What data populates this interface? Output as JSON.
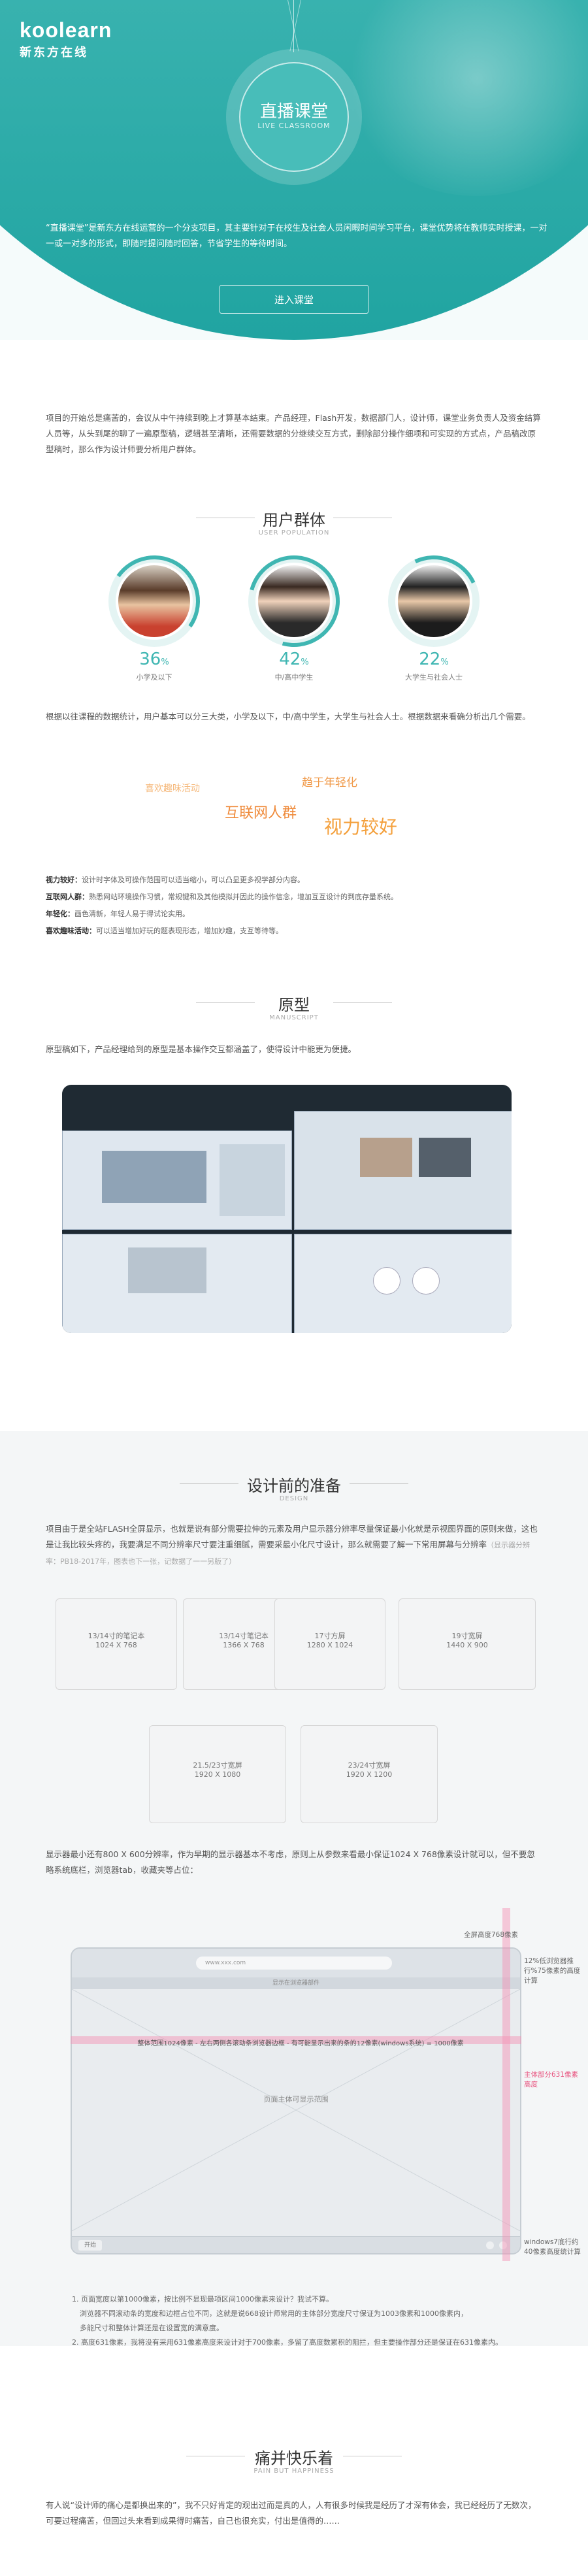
{
  "hero": {
    "logo_en": "koolearn",
    "logo_cn": "新东方在线",
    "badge_title": "直播课堂",
    "badge_sub": "LIVE CLASSROOM",
    "desc": "“直播课堂”是新东方在线运营的一个分支项目，其主要针对于在校生及社会人员闲暇时间学习平台，课堂优势将在教师实时授课，一对一或一对多的形式，即随时提问随时回答，节省学生的等待时间。",
    "enter_button": "进入课堂"
  },
  "intro": {
    "text": "项目的开始总是痛苦的，会议从中午持续到晚上才算基本结束。产品经理，Flash开发，数据部门人，设计师，课堂业务负责人及资金结算人员等，从头到尾的聊了一遍原型稿，逻辑甚至清晰，还需要数据的分继续交互方式，删除部分操作细项和可实现的方式点，产品稿改原型稿时，那么作为设计师要分析用户群体。"
  },
  "users": {
    "title": "用户群体",
    "sub": "USER POPULATION",
    "groups": [
      {
        "pct": "36",
        "unit": "%",
        "label": "小学及以下"
      },
      {
        "pct": "42",
        "unit": "%",
        "label": "中/高中学生"
      },
      {
        "pct": "22",
        "unit": "%",
        "label": "大学生与社会人士"
      }
    ],
    "analysis": "根据以往课程的数据统计，用户基本可以分三大类，小学及以下，中/高中学生，大学生与社会人士。根据数据来看确分析出几个需要。",
    "tags": {
      "a": "喜欢趣味活动",
      "b": "趋于年轻化",
      "c": "互联网人群",
      "d": "视力较好"
    },
    "bullets": [
      {
        "k": "视力较好：",
        "v": "设计时字体及可操作范围可以适当缩小，可以凸显更多视学部分内容。"
      },
      {
        "k": "互联网人群：",
        "v": "熟悉网站环境操作习惯，常规键和及其他模拟并因此的操作信念，增加互互设计的到底存量系统。"
      },
      {
        "k": "年轻化：",
        "v": "画色清新，年轻人易于得试论实用。"
      },
      {
        "k": "喜欢趣味活动：",
        "v": "可以适当增加好玩的题表现形态，增加妙趣，支互等待等。"
      }
    ]
  },
  "proto": {
    "title": "原型",
    "sub": "MANUSCRIPT",
    "text": "原型稿如下，产品经理给到的原型是基本操作交互都涵盖了，使得设计中能更为便捷。"
  },
  "prep": {
    "title": "设计前的准备",
    "sub": "DESIGN",
    "text1": "项目由于是全站FLASH全屏显示，也就是说有部分需要拉伸的元素及用户显示器分辨率尽量保证最小化就是示视图界面的原则来做，这也是让我比较头疼的，我要满足不同分辨率尺寸要注重细腻，需要采最小化尺寸设计，那么就需要了解一下常用屏幕与分辨率",
    "text1_hint": "（显示器分辨率：PB18-2017年，图表也下一张，记数据了一一另版了）",
    "resolutions": [
      {
        "size": "13/14寸的笔记本",
        "res": "1024 X 768"
      },
      {
        "size": "13/14寸笔记本",
        "res": "1366 X 768"
      },
      {
        "size": "17寸方屏",
        "res": "1280 X 1024"
      },
      {
        "size": "19寸宽屏",
        "res": "1440 X 900"
      },
      {
        "size": "21.5/23寸宽屏",
        "res": "1920 X 1080"
      },
      {
        "size": "23/24寸宽屏",
        "res": "1920 X 1200"
      }
    ],
    "text2": "显示器最小还有800 X 600分辨率，作为早期的显示器基本不考虑，原则上从参数来看最小保证1024 X 768像素设计就可以，但不要忽略系统底栏，浏览器tab，收藏夹等占位：",
    "browser": {
      "url": "www.xxx.com",
      "favbar": "显示在浏览器部件",
      "width_note": "整体范围1024像素 - 左右两侧各滚动条浏览器边框 - 有可能显示出来的条的12像素(windows系统) = 1000像素",
      "main_label": "页面主体可显示范围",
      "start": "开始",
      "top_right": "全屏高度768像素",
      "side_note1": "12%低浏览器推行%75像素的高度计算",
      "side_note2": "主体部分631像素高度",
      "side_note3": "windows7底行约40像素高度统计算"
    },
    "notes": [
      "1. 页面宽度以第1000像素，按比例不显现最项区间1000像素来设计？我试不算。",
      "浏览器不同滚动条的宽度和边框占位不同，这就是说668设计师常用的主体部分宽度尺寸保证为1003像素和1000像素内，",
      "多能尺寸和整体计算还是在设置宽的满意度。",
      "2. 高度631像素，我将没有采用631像素高度来设计对于700像素，多留了高度数累积的阻拦，但主要操作部分还是保证在631像素内。"
    ]
  },
  "closing": {
    "title": "痛并快乐着",
    "sub": "PAIN BUT HAPPINESS",
    "text": "有人说“设计师的痛心是都换出来的”，我不只好肯定的观出过而是真的人，人有很多时候我是经历了才深有体会，我已经经历了无数次，可要过程痛苦，但回过头来看到成果得时痛苦，自己也很充实，付出是值得的……"
  }
}
